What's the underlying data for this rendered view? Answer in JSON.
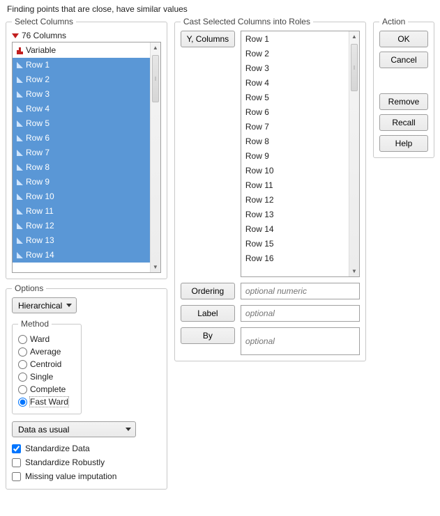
{
  "caption": "Finding points that are close, have similar values",
  "select_columns": {
    "legend": "Select Columns",
    "count_label": "76 Columns",
    "variable_label": "Variable",
    "rows": [
      "Row 1",
      "Row 2",
      "Row 3",
      "Row 4",
      "Row 5",
      "Row 6",
      "Row 7",
      "Row 8",
      "Row 9",
      "Row 10",
      "Row 11",
      "Row 12",
      "Row 13",
      "Row 14"
    ]
  },
  "cast": {
    "legend": "Cast Selected Columns into Roles",
    "y_label": "Y, Columns",
    "y_rows": [
      "Row 1",
      "Row 2",
      "Row 3",
      "Row 4",
      "Row 5",
      "Row 6",
      "Row 7",
      "Row 8",
      "Row 9",
      "Row 10",
      "Row 11",
      "Row 12",
      "Row 13",
      "Row 14",
      "Row 15",
      "Row 16"
    ],
    "ordering_label": "Ordering",
    "ordering_placeholder": "optional numeric",
    "label_label": "Label",
    "label_placeholder": "optional",
    "by_label": "By",
    "by_placeholder": "optional"
  },
  "options": {
    "legend": "Options",
    "algorithm_combo": "Hierarchical",
    "method_legend": "Method",
    "methods": [
      "Ward",
      "Average",
      "Centroid",
      "Single",
      "Complete",
      "Fast Ward"
    ],
    "method_selected": "Fast Ward",
    "data_combo": "Data as usual",
    "standardize_label": "Standardize Data",
    "standardize_checked": true,
    "standardize_robust_label": "Standardize Robustly",
    "standardize_robust_checked": false,
    "missing_label": "Missing value imputation",
    "missing_checked": false
  },
  "action": {
    "legend": "Action",
    "ok": "OK",
    "cancel": "Cancel",
    "remove": "Remove",
    "recall": "Recall",
    "help": "Help"
  }
}
